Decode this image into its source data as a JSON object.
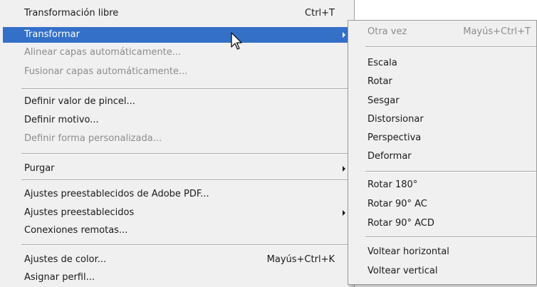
{
  "main_menu": {
    "items": [
      {
        "label": "Transformación libre",
        "shortcut": "Ctrl+T"
      },
      {
        "label": "Transformar"
      },
      {
        "label": "Alinear capas automáticamente..."
      },
      {
        "label": "Fusionar capas automáticamente..."
      },
      {
        "label": "Definir valor de pincel..."
      },
      {
        "label": "Definir motivo..."
      },
      {
        "label": "Definir forma personalizada..."
      },
      {
        "label": "Purgar"
      },
      {
        "label": "Ajustes preestablecidos de Adobe PDF..."
      },
      {
        "label": "Ajustes preestablecidos"
      },
      {
        "label": "Conexiones remotas..."
      },
      {
        "label": "Ajustes de color...",
        "shortcut": "Mayús+Ctrl+K"
      },
      {
        "label": "Asignar perfil..."
      }
    ]
  },
  "submenu": {
    "items": [
      {
        "label": "Otra vez",
        "shortcut": "Mayús+Ctrl+T"
      },
      {
        "label": "Escala"
      },
      {
        "label": "Rotar"
      },
      {
        "label": "Sesgar"
      },
      {
        "label": "Distorsionar"
      },
      {
        "label": "Perspectiva"
      },
      {
        "label": "Deformar"
      },
      {
        "label": "Rotar 180°"
      },
      {
        "label": "Rotar 90° AC"
      },
      {
        "label": "Rotar 90° ACD"
      },
      {
        "label": "Voltear horizontal"
      },
      {
        "label": "Voltear vertical"
      }
    ]
  },
  "colors": {
    "menu_bg": "#f0f0f0",
    "highlight": "#3470c8",
    "disabled_text": "#8c8c8c",
    "text": "#1a1a1a"
  },
  "icons": {
    "cursor": "mouse-pointer-icon",
    "submenu": "submenu-arrow-icon"
  }
}
